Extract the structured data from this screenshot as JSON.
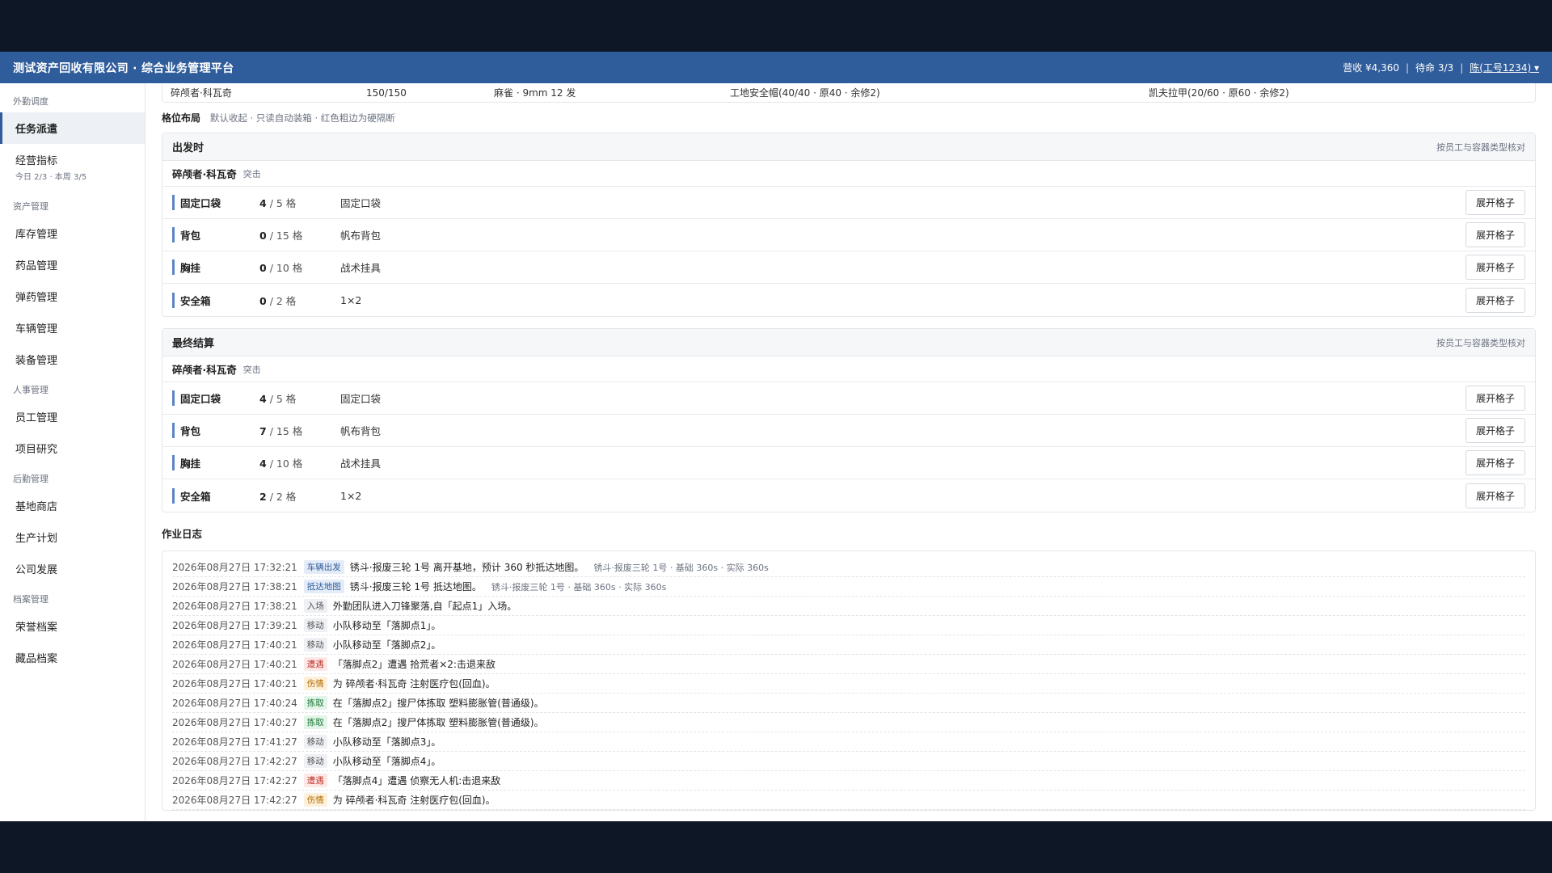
{
  "header": {
    "title": "测试资产回收有限公司 · 综合业务管理平台",
    "revenue": "营收 ¥4,360",
    "standby": "待命 3/3",
    "user": "陈(工号1234)"
  },
  "sidebar": {
    "sections": [
      {
        "title": "外勤调度",
        "items": [
          {
            "label": "任务派遣",
            "sub": ""
          },
          {
            "label": "经营指标",
            "sub": "今日 2/3 · 本周 3/5"
          }
        ]
      },
      {
        "title": "资产管理",
        "items": [
          {
            "label": "库存管理"
          },
          {
            "label": "药品管理"
          },
          {
            "label": "弹药管理"
          },
          {
            "label": "车辆管理"
          },
          {
            "label": "装备管理"
          }
        ]
      },
      {
        "title": "人事管理",
        "items": [
          {
            "label": "员工管理"
          },
          {
            "label": "项目研究"
          }
        ]
      },
      {
        "title": "后勤管理",
        "items": [
          {
            "label": "基地商店"
          },
          {
            "label": "生产计划"
          },
          {
            "label": "公司发展"
          }
        ]
      },
      {
        "title": "档案管理",
        "items": [
          {
            "label": "荣誉档案"
          },
          {
            "label": "藏品档案"
          }
        ]
      }
    ]
  },
  "crew_row": {
    "name": "碎颅者·科瓦奇",
    "hp": "150/150",
    "weapon": "麻雀 · 9mm 12 发",
    "helmet": "工地安全帽(40/40 · 原40 · 余修2)",
    "armor": "凯夫拉甲(20/60 · 原60 · 余修2)"
  },
  "grid": {
    "title": "格位布局",
    "desc": "默认收起 · 只读自动装箱 · 红色粗边为硬隔断"
  },
  "panels": [
    {
      "title": "出发时",
      "hint": "按员工与容器类型核对",
      "operator": "碎颅者·科瓦奇",
      "role": "突击",
      "slots": [
        {
          "name": "固定口袋",
          "used": "4",
          "cap": "/ 5 格",
          "type": "固定口袋",
          "btn": "展开格子"
        },
        {
          "name": "背包",
          "used": "0",
          "cap": "/ 15 格",
          "type": "帆布背包",
          "btn": "展开格子"
        },
        {
          "name": "胸挂",
          "used": "0",
          "cap": "/ 10 格",
          "type": "战术挂具",
          "btn": "展开格子"
        },
        {
          "name": "安全箱",
          "used": "0",
          "cap": "/ 2 格",
          "type": "1×2",
          "btn": "展开格子"
        }
      ]
    },
    {
      "title": "最终结算",
      "hint": "按员工与容器类型核对",
      "operator": "碎颅者·科瓦奇",
      "role": "突击",
      "slots": [
        {
          "name": "固定口袋",
          "used": "4",
          "cap": "/ 5 格",
          "type": "固定口袋",
          "btn": "展开格子"
        },
        {
          "name": "背包",
          "used": "7",
          "cap": "/ 15 格",
          "type": "帆布背包",
          "btn": "展开格子"
        },
        {
          "name": "胸挂",
          "used": "4",
          "cap": "/ 10 格",
          "type": "战术挂具",
          "btn": "展开格子"
        },
        {
          "name": "安全箱",
          "used": "2",
          "cap": "/ 2 格",
          "type": "1×2",
          "btn": "展开格子"
        }
      ]
    }
  ],
  "log": {
    "title": "作业日志",
    "entries": [
      {
        "time": "2026年08月27日 17:32:21",
        "tag": "车辆出发",
        "kind": "depart",
        "text": "锈斗·报废三轮 1号 离开基地，预计 360 秒抵达地图。",
        "sub": "锈斗·报废三轮 1号 · 基础 360s · 实际 360s"
      },
      {
        "time": "2026年08月27日 17:38:21",
        "tag": "抵达地图",
        "kind": "arrive",
        "text": "锈斗·报废三轮 1号 抵达地图。",
        "sub": "锈斗·报废三轮 1号 · 基础 360s · 实际 360s"
      },
      {
        "time": "2026年08月27日 17:38:21",
        "tag": "入场",
        "kind": "enter",
        "text": "外勤团队进入刀锋聚落,自「起点1」入场。",
        "sub": ""
      },
      {
        "time": "2026年08月27日 17:39:21",
        "tag": "移动",
        "kind": "move",
        "text": "小队移动至「落脚点1」。",
        "sub": ""
      },
      {
        "time": "2026年08月27日 17:40:21",
        "tag": "移动",
        "kind": "move",
        "text": "小队移动至「落脚点2」。",
        "sub": ""
      },
      {
        "time": "2026年08月27日 17:40:21",
        "tag": "遭遇",
        "kind": "encounter",
        "text": "「落脚点2」遭遇 拾荒者×2:击退来敌",
        "sub": ""
      },
      {
        "time": "2026年08月27日 17:40:21",
        "tag": "伤情",
        "kind": "injury",
        "text": "为 碎颅者·科瓦奇 注射医疗包(回血)。",
        "sub": ""
      },
      {
        "time": "2026年08月27日 17:40:24",
        "tag": "拣取",
        "kind": "pickup",
        "text": "在「落脚点2」搜尸体拣取 塑料膨胀管(普通级)。",
        "sub": ""
      },
      {
        "time": "2026年08月27日 17:40:27",
        "tag": "拣取",
        "kind": "pickup",
        "text": "在「落脚点2」搜尸体拣取 塑料膨胀管(普通级)。",
        "sub": ""
      },
      {
        "time": "2026年08月27日 17:41:27",
        "tag": "移动",
        "kind": "move",
        "text": "小队移动至「落脚点3」。",
        "sub": ""
      },
      {
        "time": "2026年08月27日 17:42:27",
        "tag": "移动",
        "kind": "move",
        "text": "小队移动至「落脚点4」。",
        "sub": ""
      },
      {
        "time": "2026年08月27日 17:42:27",
        "tag": "遭遇",
        "kind": "encounter",
        "text": "「落脚点4」遭遇 侦察无人机:击退来敌",
        "sub": ""
      },
      {
        "time": "2026年08月27日 17:42:27",
        "tag": "伤情",
        "kind": "injury",
        "text": "为 碎颅者·科瓦奇 注射医疗包(回血)。",
        "sub": ""
      }
    ]
  }
}
